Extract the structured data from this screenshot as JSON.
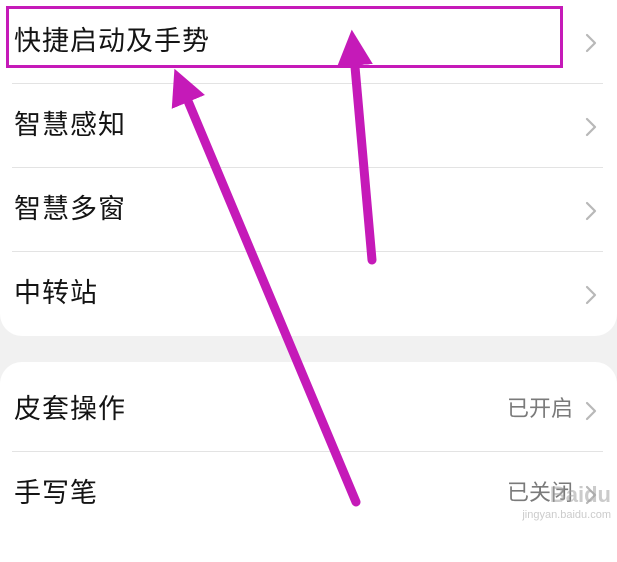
{
  "settings_group_1": {
    "items": [
      {
        "label": "快捷启动及手势"
      },
      {
        "label": "智慧感知"
      },
      {
        "label": "智慧多窗"
      },
      {
        "label": "中转站"
      }
    ]
  },
  "settings_group_2": {
    "items": [
      {
        "label": "皮套操作",
        "value": "已开启"
      },
      {
        "label": "手写笔",
        "value": "已关闭"
      }
    ]
  },
  "annotation": {
    "color": "#c51ab8"
  },
  "watermark": {
    "brand": "Baidu",
    "subtitle": "jingyan.baidu.com"
  }
}
